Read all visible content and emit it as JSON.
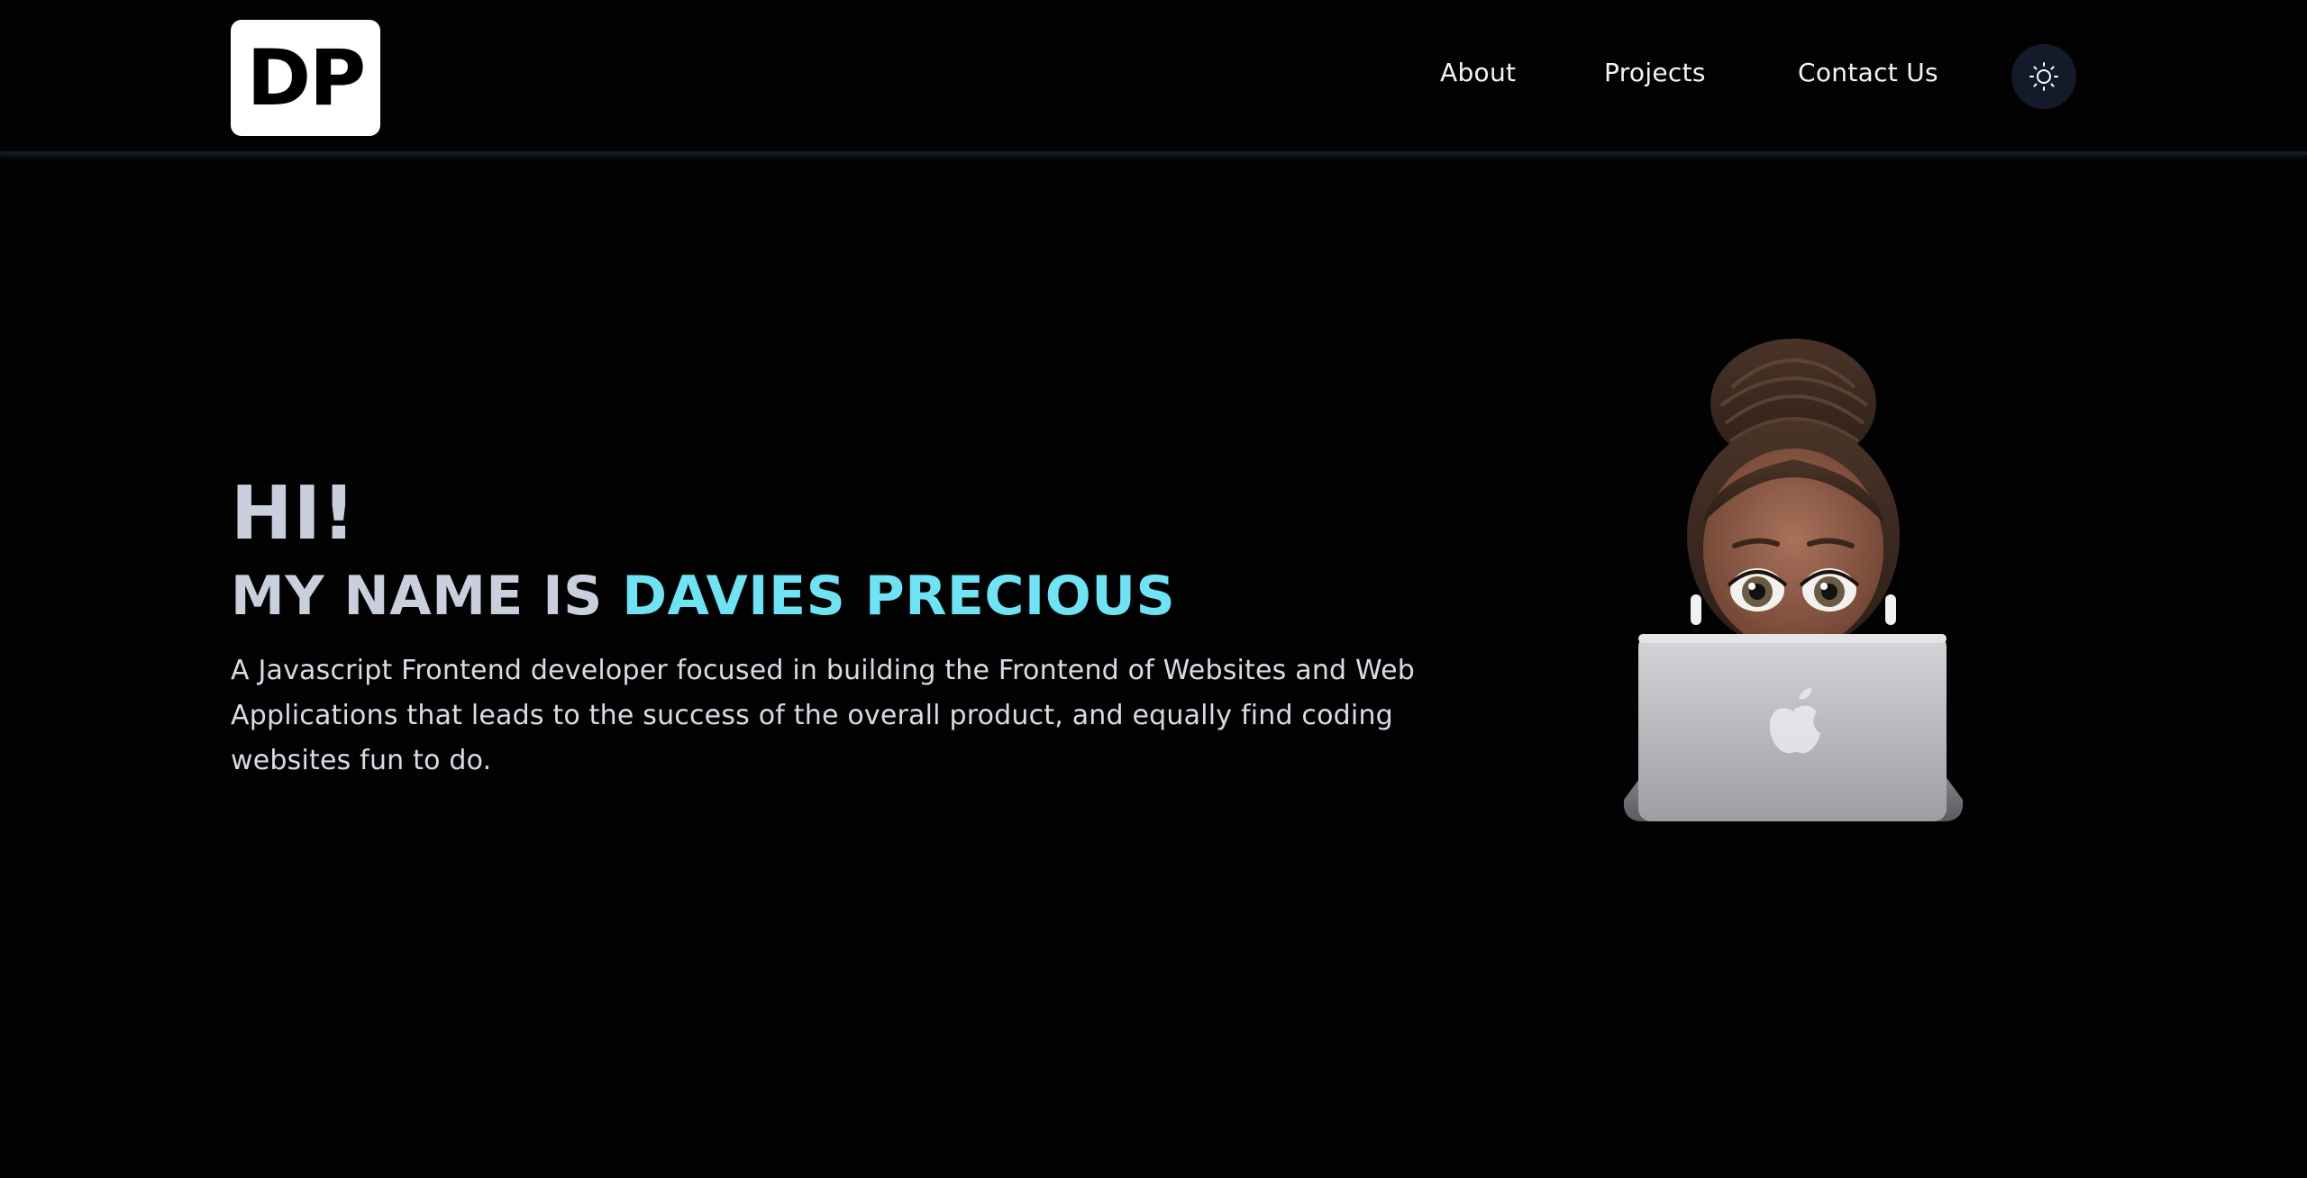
{
  "header": {
    "logo_text": "DP",
    "nav": {
      "about": "About",
      "projects": "Projects",
      "contact": "Contact Us"
    },
    "theme_toggle_icon": "sun-icon"
  },
  "hero": {
    "greeting": "HI!",
    "name_prefix": "MY NAME IS ",
    "name": "DAVIES PRECIOUS",
    "description": "A Javascript Frontend developer focused in building the Frontend of Websites and Web Applications that leads to the success of the overall product, and equally find coding websites fun to do."
  },
  "colors": {
    "background": "#020202",
    "accent": "#6fe3f3",
    "heading": "#c9cfdd",
    "toggle_bg": "#131a29"
  },
  "avatar": {
    "icon": "memoji-laptop-avatar"
  }
}
